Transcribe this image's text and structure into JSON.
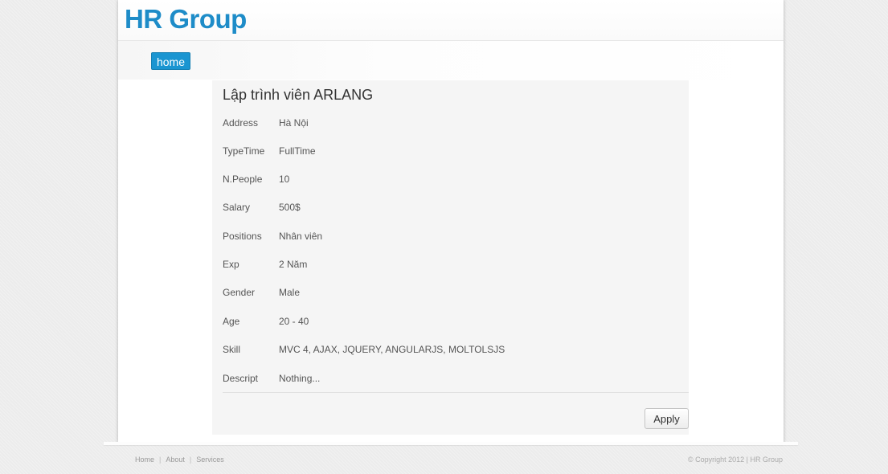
{
  "brand": {
    "title": "HR Group"
  },
  "nav": {
    "home_label": "home"
  },
  "job": {
    "title": "Lập trình viên ARLANG",
    "fields": [
      {
        "label": "Address",
        "value": "Hà Nội"
      },
      {
        "label": "TypeTime",
        "value": "FullTime"
      },
      {
        "label": "N.People",
        "value": "10"
      },
      {
        "label": "Salary",
        "value": "500$"
      },
      {
        "label": "Positions",
        "value": "Nhân viên"
      },
      {
        "label": "Exp",
        "value": "2 Năm"
      },
      {
        "label": "Gender",
        "value": "Male"
      },
      {
        "label": "Age",
        "value": "20 - 40"
      },
      {
        "label": "Skill",
        "value": "MVC 4, AJAX, JQUERY, ANGULARJS, MOLTOLSJS"
      },
      {
        "label": "Descript",
        "value": "Nothing..."
      }
    ],
    "apply_label": "Apply"
  },
  "footer": {
    "links": [
      "Home",
      "About",
      "Services"
    ],
    "separator": "|",
    "copyright": "© Copyright 2012 | HR Group"
  },
  "colors": {
    "brand": "#1e8cc8",
    "nav_active": "#1a95d1"
  }
}
